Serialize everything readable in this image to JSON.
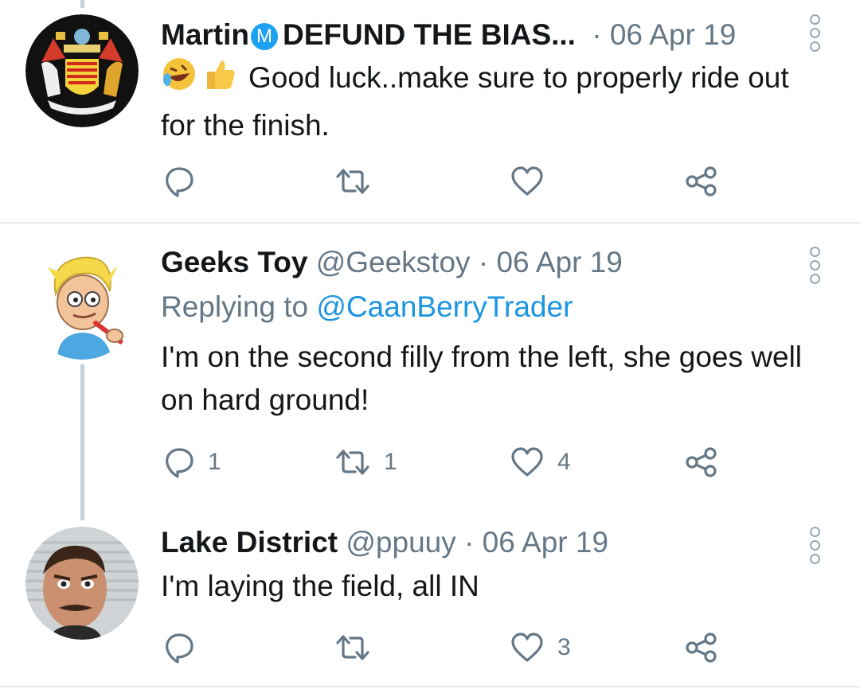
{
  "colors": {
    "accent": "#1da1f2",
    "mention": "#1b95e0",
    "muted": "#657786",
    "thread_line": "#c4cfd6"
  },
  "tweets": [
    {
      "name": "Martin",
      "badge": "M",
      "name_suffix": "DEFUND THE BIAS...",
      "separator": "·",
      "date": "06 Apr 19",
      "emojis": [
        "rolling-on-floor-laughing-emoji",
        "thumbs-up-emoji"
      ],
      "text": "Good luck..make sure to properly ride out for the finish.",
      "actions": {
        "reply": "",
        "retweet": "",
        "like": ""
      }
    },
    {
      "name": "Geeks Toy",
      "handle": "@Geekstoy",
      "separator": "·",
      "date": "06 Apr 19",
      "replying_prefix": "Replying to",
      "replying_to": "@CaanBerryTrader",
      "text": "I'm on the second filly from the left, she goes well on hard ground!",
      "actions": {
        "reply": "1",
        "retweet": "1",
        "like": "4"
      }
    },
    {
      "name": "Lake District",
      "handle": "@ppuuy",
      "separator": "·",
      "date": "06 Apr 19",
      "text": "I'm laying the field, all IN",
      "actions": {
        "reply": "",
        "retweet": "",
        "like": "3"
      }
    }
  ]
}
